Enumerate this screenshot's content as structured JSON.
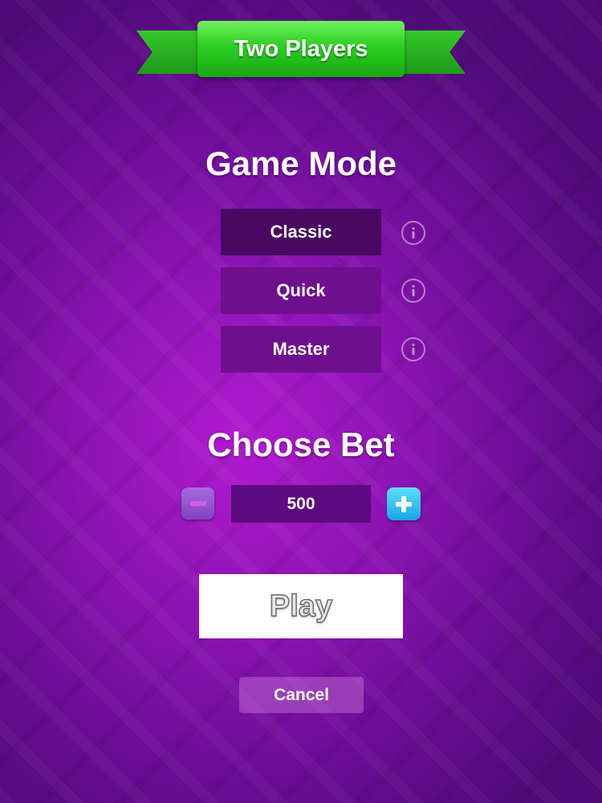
{
  "banner": {
    "title": "Two Players"
  },
  "game_mode": {
    "title": "Game Mode",
    "selected": "Classic",
    "modes": [
      {
        "label": "Classic"
      },
      {
        "label": "Quick"
      },
      {
        "label": "Master"
      }
    ]
  },
  "bet": {
    "title": "Choose Bet",
    "value": "500"
  },
  "actions": {
    "play_label": "Play",
    "cancel_label": "Cancel"
  },
  "colors": {
    "background": "#8f14b6",
    "banner_green": "#2ccf22",
    "plus_button": "#1aa3e6",
    "minus_button": "#7f41c4"
  },
  "icons": [
    "info-icon",
    "minus-icon",
    "plus-icon"
  ]
}
